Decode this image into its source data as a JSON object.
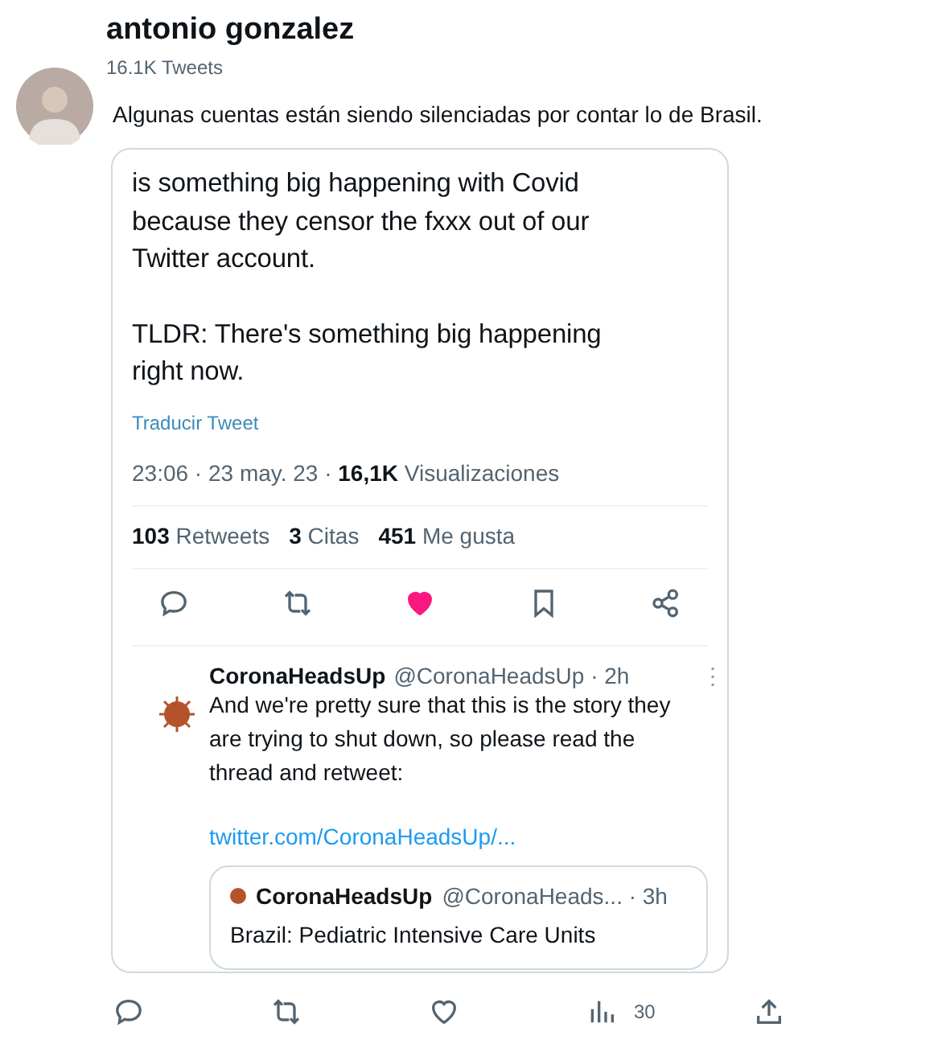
{
  "header": {
    "name": "antonio gonzalez",
    "tweet_count": "16.1K Tweets"
  },
  "tweet": {
    "text": "Algunas cuentas están siendo silenciadas por contar lo de Brasil."
  },
  "embedded": {
    "paragraphs": [
      "is something big happening with Covid\nbecause they censor the fxxx out of our\nTwitter account.",
      "TLDR: There's something big happening\nright now."
    ],
    "translate": "Traducir Tweet",
    "time": "23:06 · 23 may. 23 · ",
    "views": "16,1K",
    "views_label": " Visualizaciones",
    "stats": [
      {
        "count": "103",
        "label": "Retweets"
      },
      {
        "count": "3",
        "label": "Citas"
      },
      {
        "count": "451",
        "label": "Me gusta"
      }
    ],
    "actions": [
      {
        "kind": "reply"
      },
      {
        "kind": "retweet"
      },
      {
        "kind": "like",
        "selected": true
      },
      {
        "kind": "bookmark"
      },
      {
        "kind": "share"
      }
    ],
    "reply": {
      "name": "CoronaHeadsUp",
      "meta": "@CoronaHeadsUp · 2h",
      "more": "⋮",
      "paragraphs": [
        "And we're pretty sure that this is the story they\nare trying to shut down, so please read the\nthread and retweet:"
      ],
      "link": "twitter.com/CoronaHeadsUp/...",
      "quote": {
        "name": "CoronaHeadsUp",
        "meta": "@CoronaHeads... · 3h",
        "text": "Brazil: Pediatric Intensive Care Units"
      }
    }
  },
  "action_bar": [
    {
      "kind": "reply"
    },
    {
      "kind": "retweet"
    },
    {
      "kind": "like"
    },
    {
      "kind": "views",
      "count": "30"
    },
    {
      "kind": "share"
    }
  ]
}
